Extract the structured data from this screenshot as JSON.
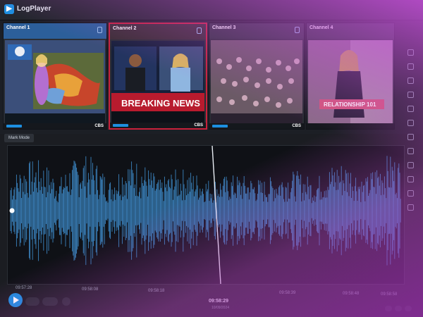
{
  "app": {
    "title": "LogPlayer"
  },
  "channels": [
    {
      "name": "Channel 1",
      "state": "active",
      "network": "CBS"
    },
    {
      "name": "Channel 2",
      "state": "alert",
      "banner": "BREAKING NEWS",
      "network": "CBS"
    },
    {
      "name": "Channel 3",
      "state": "normal",
      "network": "CBS"
    },
    {
      "name": "Channel 4",
      "state": "normal",
      "banner": "RELATIONSHIP 101"
    }
  ],
  "toolbar": {
    "mark_mode_label": "Mark Mode"
  },
  "timeline": {
    "ticks": [
      "09:57:28",
      "09:58:08",
      "09:58:18",
      "09:58:39",
      "09:58:48",
      "09:58:58"
    ],
    "current_time": "09:58:29",
    "current_date": "10/09/2024"
  },
  "icons": [
    "play-icon",
    "rewind-icon",
    "skip-back-icon",
    "skip-forward-icon",
    "settings-icon",
    "lock-icon",
    "search-icon",
    "menu-icon"
  ],
  "colors": {
    "accent": "#1d8fe0",
    "alert": "#c8213b",
    "waveform": "#3f8fd0",
    "background": "#1c1f25"
  }
}
